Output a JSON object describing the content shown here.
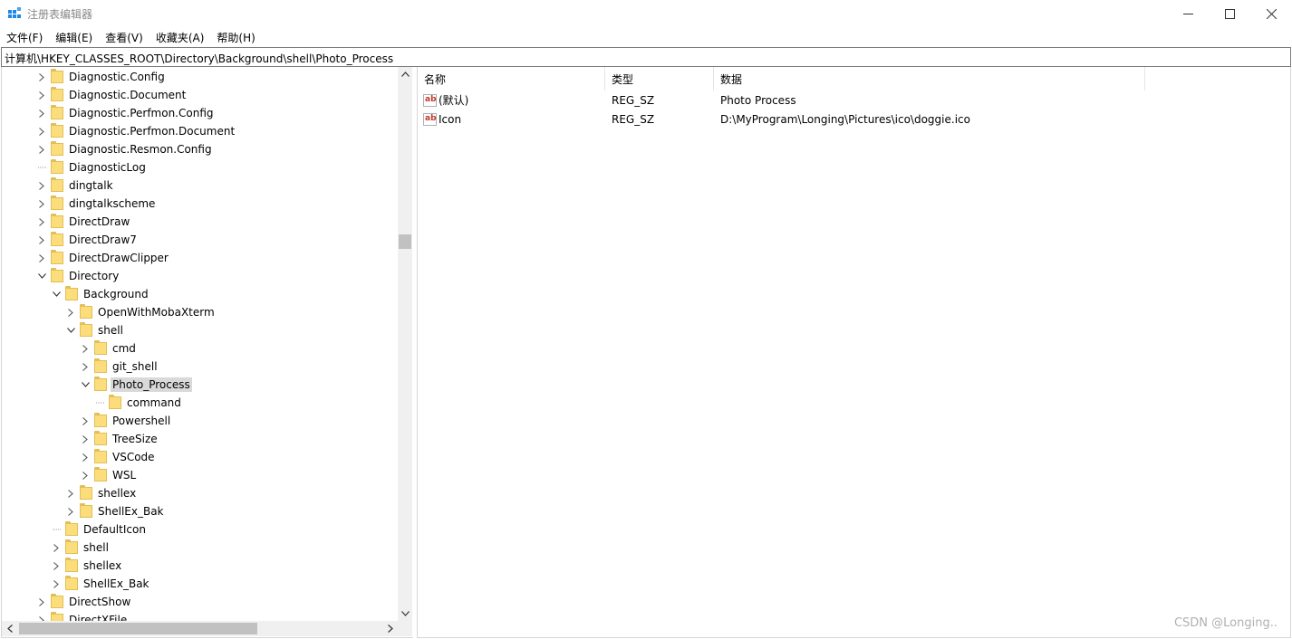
{
  "window": {
    "title": "注册表编辑器",
    "icon": "regedit-icon"
  },
  "menu": [
    "文件(F)",
    "编辑(E)",
    "查看(V)",
    "收藏夹(A)",
    "帮助(H)"
  ],
  "address": "计算机\\HKEY_CLASSES_ROOT\\Directory\\Background\\shell\\Photo_Process",
  "tree": [
    {
      "label": "Diagnostic.Config",
      "depth": 0,
      "expander": "collapsed"
    },
    {
      "label": "Diagnostic.Document",
      "depth": 0,
      "expander": "collapsed"
    },
    {
      "label": "Diagnostic.Perfmon.Config",
      "depth": 0,
      "expander": "collapsed"
    },
    {
      "label": "Diagnostic.Perfmon.Document",
      "depth": 0,
      "expander": "collapsed"
    },
    {
      "label": "Diagnostic.Resmon.Config",
      "depth": 0,
      "expander": "collapsed"
    },
    {
      "label": "DiagnosticLog",
      "depth": 0,
      "expander": "none"
    },
    {
      "label": "dingtalk",
      "depth": 0,
      "expander": "collapsed"
    },
    {
      "label": "dingtalkscheme",
      "depth": 0,
      "expander": "collapsed"
    },
    {
      "label": "DirectDraw",
      "depth": 0,
      "expander": "collapsed"
    },
    {
      "label": "DirectDraw7",
      "depth": 0,
      "expander": "collapsed"
    },
    {
      "label": "DirectDrawClipper",
      "depth": 0,
      "expander": "collapsed"
    },
    {
      "label": "Directory",
      "depth": 0,
      "expander": "expanded"
    },
    {
      "label": "Background",
      "depth": 1,
      "expander": "expanded"
    },
    {
      "label": "OpenWithMobaXterm",
      "depth": 2,
      "expander": "collapsed"
    },
    {
      "label": "shell",
      "depth": 2,
      "expander": "expanded"
    },
    {
      "label": "cmd",
      "depth": 3,
      "expander": "collapsed"
    },
    {
      "label": "git_shell",
      "depth": 3,
      "expander": "collapsed"
    },
    {
      "label": "Photo_Process",
      "depth": 3,
      "expander": "expanded",
      "selected": true
    },
    {
      "label": "command",
      "depth": 4,
      "expander": "none"
    },
    {
      "label": "Powershell",
      "depth": 3,
      "expander": "collapsed"
    },
    {
      "label": "TreeSize",
      "depth": 3,
      "expander": "collapsed"
    },
    {
      "label": "VSCode",
      "depth": 3,
      "expander": "collapsed"
    },
    {
      "label": "WSL",
      "depth": 3,
      "expander": "collapsed"
    },
    {
      "label": "shellex",
      "depth": 2,
      "expander": "collapsed"
    },
    {
      "label": "ShellEx_Bak",
      "depth": 2,
      "expander": "collapsed"
    },
    {
      "label": "DefaultIcon",
      "depth": 1,
      "expander": "none"
    },
    {
      "label": "shell",
      "depth": 1,
      "expander": "collapsed"
    },
    {
      "label": "shellex",
      "depth": 1,
      "expander": "collapsed"
    },
    {
      "label": "ShellEx_Bak",
      "depth": 1,
      "expander": "collapsed"
    },
    {
      "label": "DirectShow",
      "depth": 0,
      "expander": "collapsed"
    },
    {
      "label": "DirectXFile",
      "depth": 0,
      "expander": "collapsed"
    }
  ],
  "columns": [
    "名称",
    "类型",
    "数据"
  ],
  "values": [
    {
      "name": "(默认)",
      "type": "REG_SZ",
      "data": "Photo Process"
    },
    {
      "name": "Icon",
      "type": "REG_SZ",
      "data": "D:\\MyProgram\\Longing\\Pictures\\ico\\doggie.ico"
    }
  ],
  "value_icon_text": "ab",
  "watermark": "CSDN @Longing.."
}
